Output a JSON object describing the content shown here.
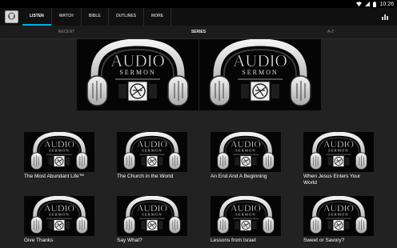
{
  "status": {
    "time": "10:26"
  },
  "tabs": [
    {
      "label": "LISTEN",
      "active": true
    },
    {
      "label": "WATCH",
      "active": false
    },
    {
      "label": "BIBLE",
      "active": false
    },
    {
      "label": "OUTLINES",
      "active": false
    },
    {
      "label": "MORE",
      "active": false
    }
  ],
  "subtabs": [
    {
      "label": "RECENT",
      "active": false
    },
    {
      "label": "SERIES",
      "active": true
    },
    {
      "label": "A-Z",
      "active": false
    }
  ],
  "artwork": {
    "line1": "AUDIO",
    "line2": "SERMON"
  },
  "featured": [
    {
      "label": ""
    },
    {
      "label": ""
    }
  ],
  "sermons": [
    {
      "title": "The Most Abundant Life™"
    },
    {
      "title": "The Church in the World"
    },
    {
      "title": "An End And A Beginning"
    },
    {
      "title": "When Jesus Enters Your World"
    },
    {
      "title": "Give Thanks"
    },
    {
      "title": "Say What?"
    },
    {
      "title": "Lessons from Israel"
    },
    {
      "title": "Sweet or Savory?"
    }
  ],
  "colors": {
    "accent": "#00aee0",
    "background": "#222222",
    "appbar": "#101010"
  }
}
